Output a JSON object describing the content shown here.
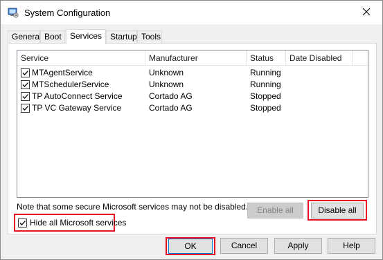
{
  "window": {
    "title": "System Configuration",
    "icon": "system-config-icon",
    "close_icon": "close-icon"
  },
  "tabs": [
    {
      "label": "General"
    },
    {
      "label": "Boot"
    },
    {
      "label": "Services",
      "active": true
    },
    {
      "label": "Startup"
    },
    {
      "label": "Tools"
    }
  ],
  "services": {
    "columns": [
      "Service",
      "Manufacturer",
      "Status",
      "Date Disabled"
    ],
    "rows": [
      {
        "checked": true,
        "service": "MTAgentService",
        "manufacturer": "Unknown",
        "status": "Running",
        "date_disabled": ""
      },
      {
        "checked": true,
        "service": "MTSchedulerService",
        "manufacturer": "Unknown",
        "status": "Running",
        "date_disabled": ""
      },
      {
        "checked": true,
        "service": "TP AutoConnect Service",
        "manufacturer": "Cortado AG",
        "status": "Stopped",
        "date_disabled": ""
      },
      {
        "checked": true,
        "service": "TP VC Gateway Service",
        "manufacturer": "Cortado AG",
        "status": "Stopped",
        "date_disabled": ""
      }
    ],
    "note": "Note that some secure Microsoft services may not be disabled.",
    "enable_all_label": "Enable all",
    "disable_all_label": "Disable all",
    "hide_ms_label": "Hide all Microsoft services",
    "hide_ms_checked": true
  },
  "footer": {
    "ok_label": "OK",
    "cancel_label": "Cancel",
    "apply_label": "Apply",
    "help_label": "Help"
  },
  "colors": {
    "highlight_box": "#e81123",
    "window_bg": "#f0f0f0",
    "button_bg": "#e1e1e1",
    "focus_border": "#0078d7"
  }
}
